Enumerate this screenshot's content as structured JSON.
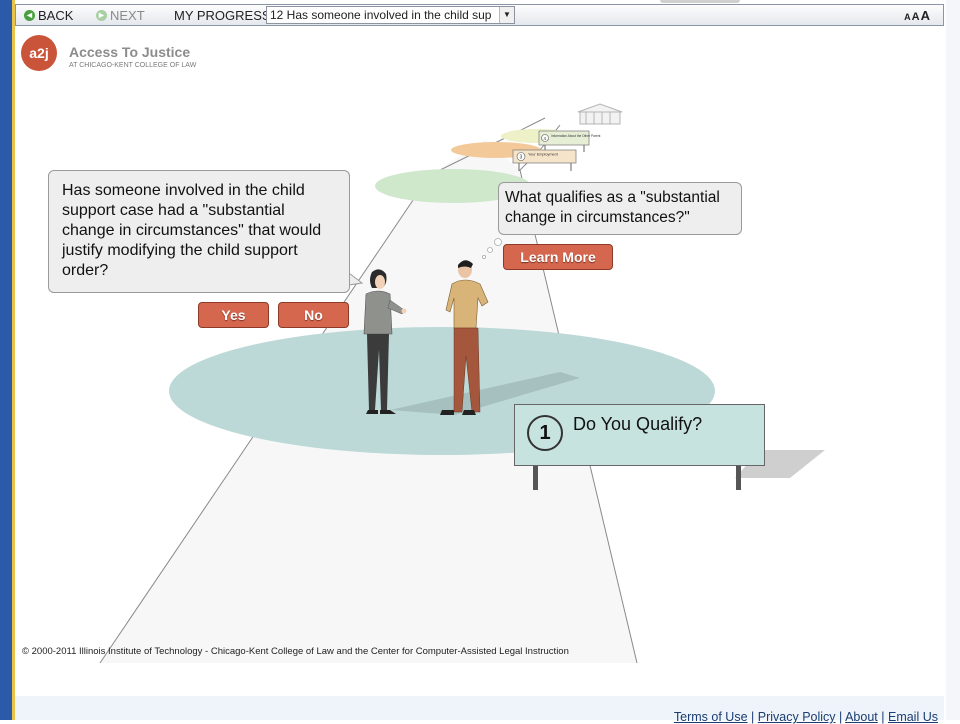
{
  "toolbar": {
    "back_label": "BACK",
    "next_label": "NEXT",
    "progress_label": "MY PROGRESS",
    "progress_selected": "12 Has someone involved in the child sup",
    "font_sizes": [
      "A",
      "A",
      "A"
    ]
  },
  "logo": {
    "mark": "a2j",
    "title": "Access To Justice",
    "subtitle": "AT CHICAGO-KENT COLLEGE OF LAW"
  },
  "question": {
    "text": "Has someone involved in the child support case had a \"substantial change in circumstances\" that would justify modifying the child support order?",
    "yes_label": "Yes",
    "no_label": "No"
  },
  "info": {
    "text": "What qualifies as a \"substantial change in circumstances?\"",
    "learn_more_label": "Learn More"
  },
  "sign": {
    "number": "1",
    "title": "Do You Qualify?"
  },
  "path_signs": [
    {
      "number": "3",
      "label": "Your Employment"
    },
    {
      "number": "4",
      "label": "Information About the Other Parent"
    }
  ],
  "copyright": "© 2000-2011 Illinois Institute of Technology - Chicago-Kent College of Law and the Center for Computer-Assisted Legal Instruction",
  "footer": {
    "terms": "Terms of Use",
    "privacy": "Privacy Policy",
    "about": "About",
    "email": "Email Us",
    "separator": "|"
  },
  "colors": {
    "accent_button": "#d5674f",
    "logo": "#c9543a",
    "sign_bg": "#c6e3e0",
    "ellipse_main": "#bcd9d8",
    "ellipse_green": "#cfe8cc",
    "ellipse_orange": "#f3c99a",
    "ellipse_yellow": "#eef0c8"
  }
}
